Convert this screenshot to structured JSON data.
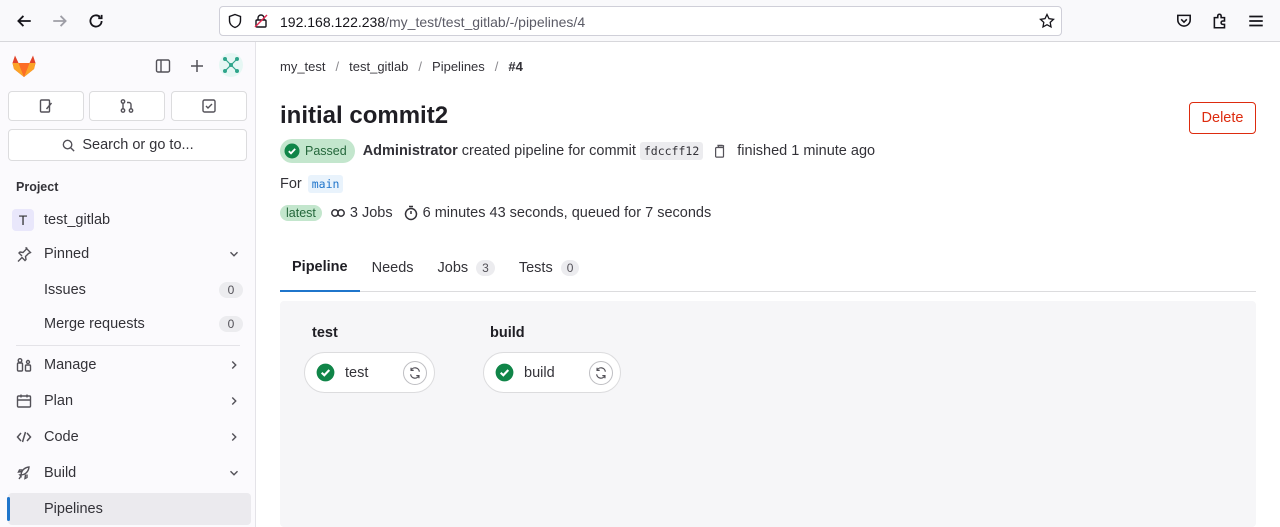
{
  "browser": {
    "url_host": "192.168.122.238",
    "url_path": "/my_test/test_gitlab/-/pipelines/4"
  },
  "sidebar": {
    "search_label": "Search or go to...",
    "section_label": "Project",
    "project": {
      "initial": "T",
      "name": "test_gitlab"
    },
    "pinned_label": "Pinned",
    "pinned_items": [
      {
        "label": "Issues",
        "count": "0"
      },
      {
        "label": "Merge requests",
        "count": "0"
      }
    ],
    "nav": [
      {
        "label": "Manage",
        "icon": "users-icon"
      },
      {
        "label": "Plan",
        "icon": "calendar-icon"
      },
      {
        "label": "Code",
        "icon": "code-icon"
      },
      {
        "label": "Build",
        "icon": "rocket-icon"
      }
    ],
    "active_item": "Pipelines"
  },
  "breadcrumb": [
    "my_test",
    "test_gitlab",
    "Pipelines",
    "#4"
  ],
  "pipeline": {
    "title": "initial commit2",
    "delete_label": "Delete",
    "status": "Passed",
    "author": "Administrator",
    "created_text": "created pipeline for commit",
    "commit_sha": "fdccff12",
    "finished_text": "finished 1 minute ago",
    "for_label": "For",
    "branch": "main",
    "latest_label": "latest",
    "jobs_text": "3 Jobs",
    "duration_text": "6 minutes 43 seconds, queued for 7 seconds"
  },
  "tabs": [
    {
      "label": "Pipeline",
      "count": null
    },
    {
      "label": "Needs",
      "count": null
    },
    {
      "label": "Jobs",
      "count": "3"
    },
    {
      "label": "Tests",
      "count": "0"
    }
  ],
  "stages": [
    {
      "title": "test",
      "job": "test"
    },
    {
      "title": "build",
      "job": "build"
    }
  ],
  "colors": {
    "accent": "#1f75cb",
    "success": "#108548",
    "danger": "#dd2b0e"
  }
}
